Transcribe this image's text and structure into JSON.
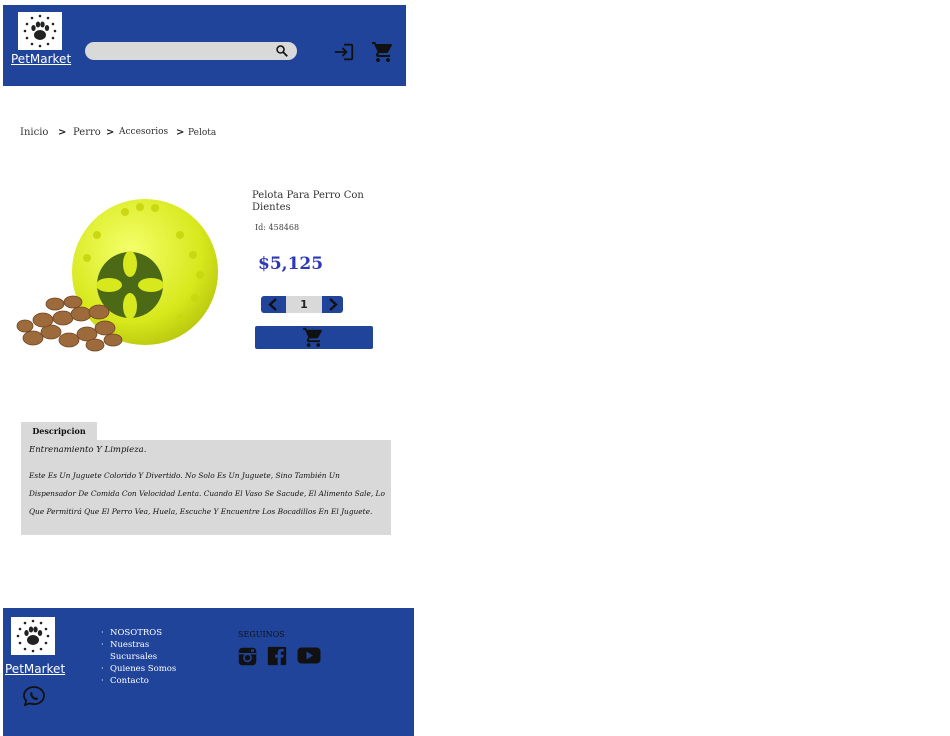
{
  "header": {
    "brand": "PetMarket",
    "search_placeholder": ""
  },
  "breadcrumb": [
    "Inicio",
    "Perro",
    "Accesorios",
    "Pelota"
  ],
  "product": {
    "title": "Pelota Para Perro Con Dientes",
    "id_label": "Id: 458468",
    "price": "$5,125",
    "quantity": "1"
  },
  "description": {
    "tab_label": "Descripcion",
    "heading": "Entrenamiento Y Limpieza.",
    "body": "Este Es Un Juguete Colorido Y Divertido. No Solo Es Un Juguete, Sino También Un Dispensador De Comida Con Velocidad Lenta. Cuando El Vaso Se Sacude, El Alimento Sale, Lo Que Permitirá Que El Perro Vea, Huela, Escuche Y Encuentre Los Bocadillos En El Juguete."
  },
  "footer": {
    "brand": "PetMarket",
    "links": [
      "NOSOTROS",
      "Nuestras Sucursales",
      "Quienes Somos",
      "Contacto"
    ],
    "follow_label": "SEGUINOS"
  },
  "icons": [
    "paw-logo",
    "search-icon",
    "login-icon",
    "cart-icon",
    "chevron-left-icon",
    "chevron-right-icon",
    "whatsapp-icon",
    "instagram-icon",
    "facebook-icon",
    "youtube-icon"
  ],
  "colors": {
    "primary": "#21449b",
    "price": "#2d38b6",
    "panel": "#d9d9d9"
  }
}
